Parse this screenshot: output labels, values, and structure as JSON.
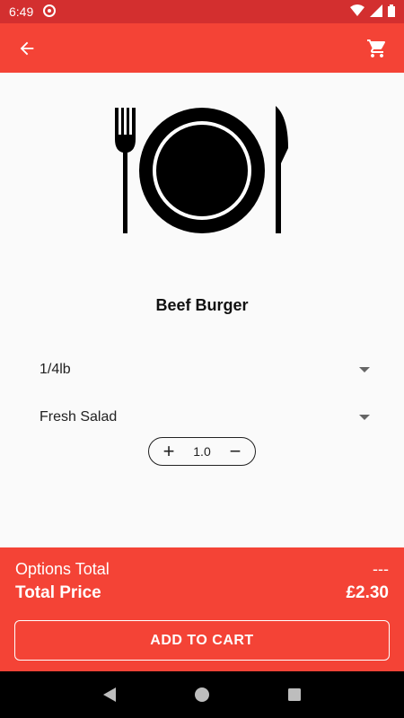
{
  "status_bar": {
    "time": "6:49"
  },
  "app_bar": {
    "back_icon": "arrow-back-icon",
    "cart_icon": "cart-icon"
  },
  "product": {
    "image_icon": "plate-fork-knife-icon",
    "name": "Beef Burger"
  },
  "options": [
    {
      "selected": "1/4lb"
    },
    {
      "selected": "Fresh Salad"
    }
  ],
  "quantity": {
    "value": "1.0"
  },
  "totals": {
    "options_label": "Options Total",
    "options_value": "---",
    "price_label": "Total Price",
    "price_value": "£2.30"
  },
  "actions": {
    "add_to_cart": "ADD TO CART"
  },
  "colors": {
    "primary": "#f44336",
    "primary_dark": "#d32f2f"
  }
}
